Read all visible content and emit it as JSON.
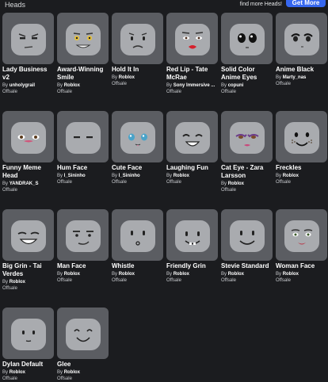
{
  "header": {
    "title": "Heads",
    "find_more": "find more Heads!",
    "get_more_label": "Get More"
  },
  "items": [
    {
      "name": "Lady Business v2",
      "by_prefix": "By",
      "creator": "unholygrail",
      "price": "Offsale",
      "icon": "lady-business-face-icon"
    },
    {
      "name": "Award-Winning Smile",
      "by_prefix": "By",
      "creator": "Roblox",
      "price": "Offsale",
      "icon": "award-smile-face-icon"
    },
    {
      "name": "Hold It In",
      "by_prefix": "By",
      "creator": "Roblox",
      "price": "Offsale",
      "icon": "hold-it-in-face-icon"
    },
    {
      "name": "Red Lip - Tate McRae",
      "by_prefix": "By",
      "creator": "Sony Immersive ...",
      "price": "Offsale",
      "icon": "red-lip-face-icon"
    },
    {
      "name": "Solid Color Anime Eyes",
      "by_prefix": "By",
      "creator": "copuni",
      "price": "Offsale",
      "icon": "anime-eyes-face-icon"
    },
    {
      "name": "Anime Black",
      "by_prefix": "By",
      "creator": "Marty_nas",
      "price": "Offsale",
      "icon": "anime-black-face-icon"
    },
    {
      "name": "Funny Meme Head",
      "by_prefix": "By",
      "creator": "YANDRAK_S",
      "price": "Offsale",
      "icon": "funny-meme-face-icon"
    },
    {
      "name": "Hum Face",
      "by_prefix": "By",
      "creator": "I_Sininho",
      "price": "Offsale",
      "icon": "hum-face-icon"
    },
    {
      "name": "Cute Face",
      "by_prefix": "By",
      "creator": "I_Sininho",
      "price": "Offsale",
      "icon": "cute-face-icon"
    },
    {
      "name": "Laughing Fun",
      "by_prefix": "By",
      "creator": "Roblox",
      "price": "Offsale",
      "icon": "laughing-face-icon"
    },
    {
      "name": "Cat Eye - Zara Larsson",
      "by_prefix": "By",
      "creator": "Roblox",
      "price": "Offsale",
      "icon": "cat-eye-face-icon"
    },
    {
      "name": "Freckles",
      "by_prefix": "By",
      "creator": "Roblox",
      "price": "Offsale",
      "icon": "freckles-face-icon"
    },
    {
      "name": "Big Grin - Tai Verdes",
      "by_prefix": "By",
      "creator": "Roblox",
      "price": "Offsale",
      "icon": "big-grin-face-icon"
    },
    {
      "name": "Man Face",
      "by_prefix": "By",
      "creator": "Roblox",
      "price": "Offsale",
      "icon": "man-face-icon"
    },
    {
      "name": "Whistle",
      "by_prefix": "By",
      "creator": "Roblox",
      "price": "Offsale",
      "icon": "whistle-face-icon"
    },
    {
      "name": "Friendly Grin",
      "by_prefix": "By",
      "creator": "Roblox",
      "price": "Offsale",
      "icon": "friendly-grin-face-icon"
    },
    {
      "name": "Stevie Standard",
      "by_prefix": "By",
      "creator": "Roblox",
      "price": "Offsale",
      "icon": "stevie-standard-face-icon"
    },
    {
      "name": "Woman Face",
      "by_prefix": "By",
      "creator": "Roblox",
      "price": "Offsale",
      "icon": "woman-face-icon"
    },
    {
      "name": "Dylan Default",
      "by_prefix": "By",
      "creator": "Roblox",
      "price": "Offsale",
      "icon": "dylan-default-face-icon"
    },
    {
      "name": "Glee",
      "by_prefix": "By",
      "creator": "Roblox",
      "price": "Offsale",
      "icon": "glee-face-icon"
    }
  ],
  "colors": {
    "background": "#1b1c1f",
    "tile": "#5b5d62",
    "head": "#a9abaf",
    "accent": "#3667ef"
  }
}
